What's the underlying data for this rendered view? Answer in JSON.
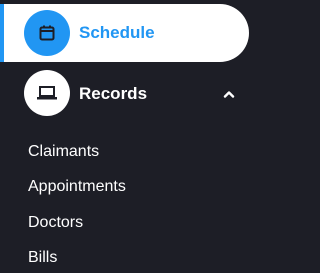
{
  "sidebar": {
    "active_item": {
      "label": "Schedule",
      "icon": "calendar-icon"
    },
    "group": {
      "label": "Records",
      "icon": "laptop-icon",
      "expanded": true,
      "chevron_icon": "chevron-up-icon",
      "items": [
        {
          "label": "Claimants"
        },
        {
          "label": "Appointments"
        },
        {
          "label": "Doctors"
        },
        {
          "label": "Bills"
        }
      ]
    }
  },
  "colors": {
    "background": "#1d1e26",
    "accent": "#2196f3",
    "active_bg": "#ffffff",
    "text": "#ffffff"
  }
}
